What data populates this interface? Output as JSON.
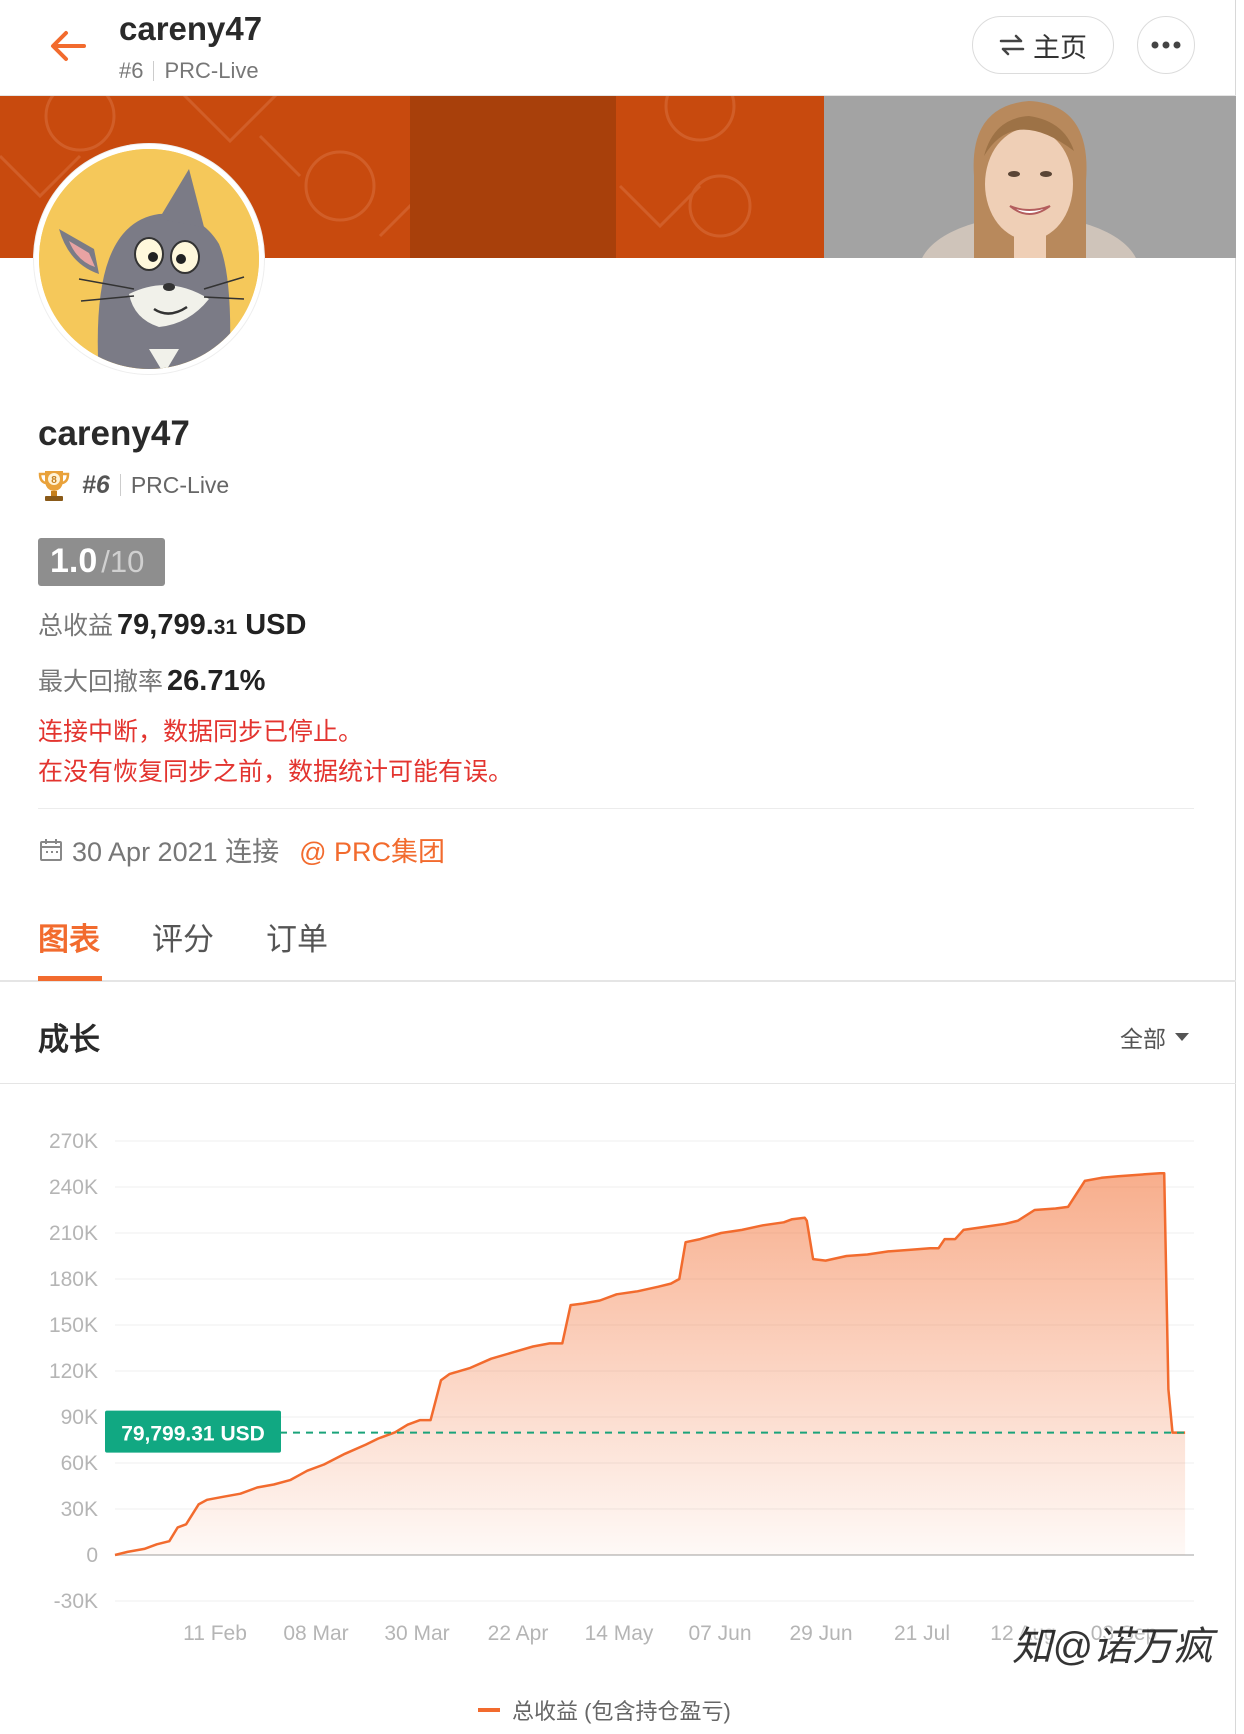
{
  "header": {
    "title": "careny47",
    "rank": "#6",
    "server": "PRC-Live",
    "home_label": "主页"
  },
  "profile": {
    "name": "careny47",
    "rank": "#6",
    "server": "PRC-Live",
    "medal_number": "8",
    "score": "1.0",
    "score_max": "/10",
    "total_profit_label": "总收益",
    "total_profit_int": "79,799.",
    "total_profit_dec": "31",
    "total_profit_unit": " USD",
    "max_drawdown_label": "最大回撤率",
    "max_drawdown_value": "26.71%",
    "warning_line1": "连接中断，数据同步已停止。",
    "warning_line2": "在没有恢复同步之前，数据统计可能有误。",
    "connect_date": "30 Apr 2021 连接",
    "group_link": "@ PRC集团"
  },
  "tabs": [
    {
      "label": "图表",
      "active": true
    },
    {
      "label": "评分",
      "active": false
    },
    {
      "label": "订单",
      "active": false
    }
  ],
  "section": {
    "title": "成长",
    "range": "全部"
  },
  "chart_data": {
    "type": "area",
    "y_ticks": [
      "270K",
      "240K",
      "210K",
      "180K",
      "150K",
      "120K",
      "90K",
      "60K",
      "30K",
      "0",
      "-30K"
    ],
    "ylim": [
      -30000,
      270000
    ],
    "x_ticks": [
      "11 Feb",
      "08 Mar",
      "30 Mar",
      "22 Apr",
      "14 May",
      "07 Jun",
      "29 Jun",
      "21 Jul",
      "12 Aug",
      "03 Sep"
    ],
    "series": [
      {
        "name": "总收益 (包含持仓盈亏)",
        "points": [
          [
            0,
            0
          ],
          [
            0.3,
            2000
          ],
          [
            0.7,
            4000
          ],
          [
            1.0,
            7000
          ],
          [
            1.3,
            9000
          ],
          [
            1.5,
            18000
          ],
          [
            1.7,
            20000
          ],
          [
            2.0,
            33000
          ],
          [
            2.2,
            36000
          ],
          [
            2.6,
            38000
          ],
          [
            3.0,
            40000
          ],
          [
            3.4,
            44000
          ],
          [
            3.8,
            46000
          ],
          [
            4.2,
            49000
          ],
          [
            4.4,
            52000
          ],
          [
            4.6,
            55000
          ],
          [
            5.0,
            59000
          ],
          [
            5.5,
            66000
          ],
          [
            6.0,
            72000
          ],
          [
            6.3,
            76000
          ],
          [
            6.7,
            80000
          ],
          [
            7.0,
            85000
          ],
          [
            7.3,
            88000
          ],
          [
            7.55,
            88000
          ],
          [
            7.8,
            114000
          ],
          [
            8.0,
            118000
          ],
          [
            8.5,
            122000
          ],
          [
            9.0,
            128000
          ],
          [
            9.5,
            132000
          ],
          [
            10.0,
            136000
          ],
          [
            10.4,
            138000
          ],
          [
            10.7,
            138000
          ],
          [
            10.9,
            163000
          ],
          [
            11.2,
            164000
          ],
          [
            11.6,
            166000
          ],
          [
            12.0,
            170000
          ],
          [
            12.5,
            172000
          ],
          [
            13.0,
            175000
          ],
          [
            13.3,
            177000
          ],
          [
            13.5,
            180000
          ],
          [
            13.65,
            204000
          ],
          [
            14.0,
            206000
          ],
          [
            14.5,
            210000
          ],
          [
            15.0,
            212000
          ],
          [
            15.5,
            215000
          ],
          [
            16.0,
            217000
          ],
          [
            16.2,
            219000
          ],
          [
            16.5,
            220000
          ],
          [
            16.55,
            218000
          ],
          [
            16.7,
            193000
          ],
          [
            17.0,
            192000
          ],
          [
            17.5,
            195000
          ],
          [
            18.0,
            196000
          ],
          [
            18.5,
            198000
          ],
          [
            19.0,
            199000
          ],
          [
            19.5,
            200000
          ],
          [
            19.7,
            200000
          ],
          [
            19.85,
            206000
          ],
          [
            20.1,
            206000
          ],
          [
            20.3,
            212000
          ],
          [
            20.8,
            214000
          ],
          [
            21.3,
            216000
          ],
          [
            21.6,
            218000
          ],
          [
            22.0,
            225000
          ],
          [
            22.5,
            226000
          ],
          [
            22.8,
            227000
          ],
          [
            23.2,
            244000
          ],
          [
            23.6,
            246000
          ],
          [
            24.0,
            247000
          ],
          [
            24.5,
            248000
          ],
          [
            25.0,
            249000
          ],
          [
            25.1,
            249000
          ],
          [
            25.2,
            108000
          ],
          [
            25.3,
            79799.31
          ],
          [
            25.6,
            79799.31
          ]
        ]
      }
    ],
    "current_value": 79799.31,
    "current_value_label": "79,799.31 USD",
    "legend": "总收益 (包含持仓盈亏)",
    "legend_position": "bottom-center",
    "grid": true,
    "colors": {
      "line": "#f26b2e",
      "fill": "#fbd5c2",
      "marker_line": "#1aa37a",
      "marker_bg": "#11a882"
    }
  },
  "watermark": "知@诺万疯",
  "colors": {
    "accent": "#f26b2e",
    "warning": "#e3342f",
    "badge": "#8e8e8e"
  }
}
